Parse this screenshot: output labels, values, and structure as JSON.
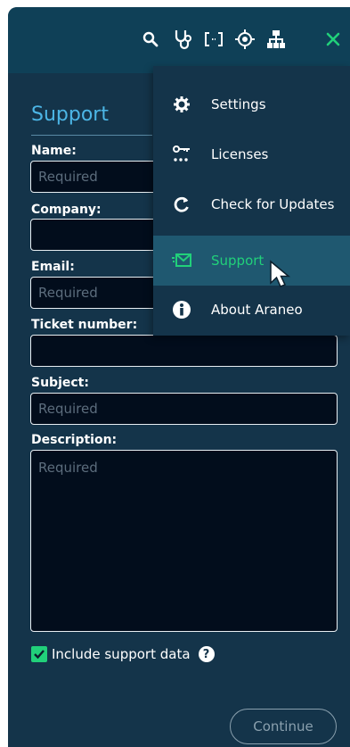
{
  "form": {
    "title": "Support",
    "fields": {
      "name": {
        "label": "Name:",
        "placeholder": "Required",
        "value": ""
      },
      "company": {
        "label": "Company:",
        "placeholder": "",
        "value": ""
      },
      "email": {
        "label": "Email:",
        "placeholder": "Required",
        "value": ""
      },
      "ticket": {
        "label": "Ticket number:",
        "placeholder": "",
        "value": ""
      },
      "subject": {
        "label": "Subject:",
        "placeholder": "Required",
        "value": ""
      },
      "description": {
        "label": "Description:",
        "placeholder": "Required",
        "value": ""
      }
    },
    "include_support_data": {
      "label": "Include support data",
      "checked": true
    },
    "help_glyph": "?",
    "continue_label": "Continue"
  },
  "toolbar": {
    "icons": [
      "search-icon",
      "stethoscope-icon",
      "brackets-icon",
      "crosshair-icon",
      "network-icon",
      "close-icon"
    ]
  },
  "menu": {
    "items": [
      {
        "label": "Settings",
        "icon": "gear-icon"
      },
      {
        "label": "Licenses",
        "icon": "key-icon"
      },
      {
        "label": "Check for Updates",
        "icon": "refresh-icon"
      },
      {
        "label": "Support",
        "icon": "envelope-icon",
        "active": true
      },
      {
        "label": "About Araneo",
        "icon": "info-icon"
      }
    ]
  },
  "colors": {
    "panel": "#14344a",
    "topbar": "#0f4057",
    "accent_green": "#21d07a",
    "title_blue": "#4cb6e6",
    "field_bg": "#020d1c",
    "menu_active": "#1f5870"
  }
}
